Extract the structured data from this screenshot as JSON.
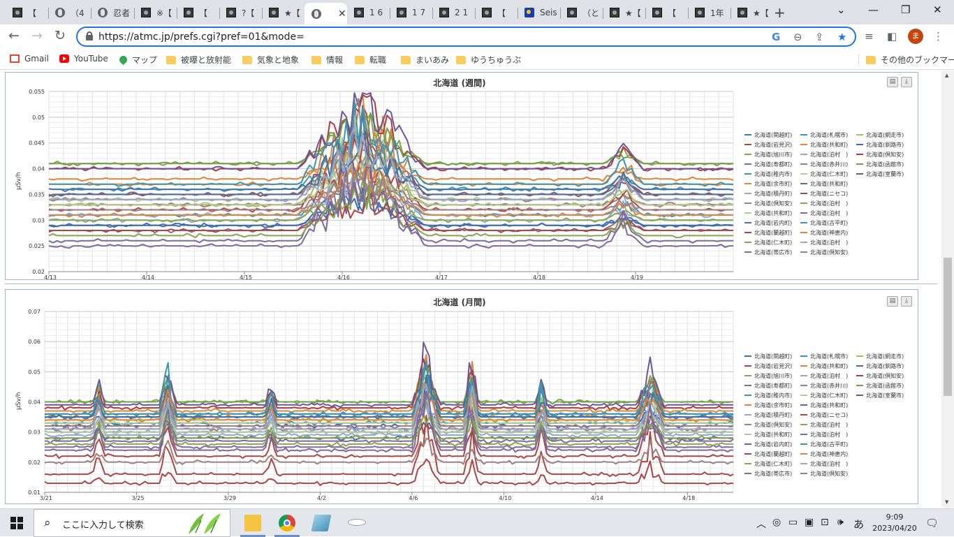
{
  "browser": {
    "tabs": [
      {
        "label": "【",
        "icon": "atmc-favicon",
        "active": false
      },
      {
        "label": "（4",
        "icon": "globe-favicon",
        "active": false
      },
      {
        "label": "忍者",
        "icon": "globe-favicon",
        "active": false
      },
      {
        "label": "※【",
        "icon": "atmc-favicon",
        "active": false
      },
      {
        "label": "【",
        "icon": "atmc-favicon",
        "active": false
      },
      {
        "label": "?【",
        "icon": "atmc-favicon",
        "active": false
      },
      {
        "label": "★【",
        "icon": "atmc-favicon",
        "active": false
      },
      {
        "label": "",
        "icon": "globe-favicon",
        "active": true
      },
      {
        "label": "1 6",
        "icon": "atmc-favicon",
        "active": false
      },
      {
        "label": "1 7",
        "icon": "atmc-favicon",
        "active": false
      },
      {
        "label": "2 1",
        "icon": "atmc-favicon",
        "active": false
      },
      {
        "label": "【",
        "icon": "atmc-favicon",
        "active": false
      },
      {
        "label": "Seis",
        "icon": "seis-favicon",
        "active": false
      },
      {
        "label": "（と",
        "icon": "atmc-favicon",
        "active": false
      },
      {
        "label": "★【",
        "icon": "atmc-favicon",
        "active": false
      },
      {
        "label": "【",
        "icon": "atmc-favicon",
        "active": false
      },
      {
        "label": "1年",
        "icon": "atmc-favicon",
        "active": false
      },
      {
        "label": "★【",
        "icon": "atmc-favicon",
        "active": false
      }
    ],
    "url": "https://atmc.jp/prefs.cgi?pref=01&mode=",
    "avatar_initial": "ま",
    "bookmarks": [
      {
        "label": "Gmail",
        "icon": "gmail-icon"
      },
      {
        "label": "YouTube",
        "icon": "youtube-icon"
      },
      {
        "label": "マップ",
        "icon": "maps-icon"
      },
      {
        "label": "被曝と放射能",
        "icon": "folder-icon"
      },
      {
        "label": "気象と地象",
        "icon": "folder-icon"
      },
      {
        "label": "情報",
        "icon": "folder-icon"
      },
      {
        "label": "転職",
        "icon": "folder-icon"
      },
      {
        "label": "まいあみ",
        "icon": "folder-icon"
      },
      {
        "label": "ゆうちゅうぶ",
        "icon": "folder-icon"
      }
    ],
    "other_bookmarks": "その他のブックマーク",
    "accent": "#1a73e8"
  },
  "taskbar": {
    "search_placeholder": "ここに入力して検索",
    "time": "9:09",
    "date": "2023/04/20",
    "ime": "あ"
  },
  "legend_labels": [
    "北海道(関越町)",
    "北海道(札幌市)",
    "北海道(網走市)",
    "北海道(岩見沢)",
    "北海道(共和町)",
    "北海道(釧路市)",
    "北海道(旭川市)",
    "北海道(泊村　)",
    "北海道(倶知安)",
    "北海道(寿都町)",
    "北海道(赤井川)",
    "北海道(函館市)",
    "北海道(稚内市)",
    "北海道(仁木町)",
    "北海道(室蘭市)",
    "北海道(余市町)",
    "北海道(共和町)",
    "北海道(積丹町)",
    "北海道(ニセコ)",
    "北海道(倶知安)",
    "北海道(泊村　)",
    "北海道(共和町)",
    "北海道(泊村　)",
    "北海道(岩内町)",
    "北海道(古平町)",
    "北海道(蘭越町)",
    "北海道(神恵内)",
    "北海道(仁木町)",
    "北海道(泊村　)",
    "北海道(帯広市)",
    "北海道(倶知安)"
  ],
  "legend_colors": [
    "#4572A7",
    "#2F9BBF",
    "#A0C060",
    "#AA4643",
    "#DB843D",
    "#3D6AB0",
    "#89A54E",
    "#92A8CD",
    "#B03A3A",
    "#80699B",
    "#A47D7C",
    "#6FA04C",
    "#3D96AE",
    "#B5CA92",
    "#6B559B",
    "#DB843D",
    "#4572A7",
    "#92A8CD",
    "#AA4643",
    "#A47D7C",
    "#89A54E",
    "#B5CA92",
    "#80699B",
    "#4572A7",
    "#3D96AE",
    "#AA4643",
    "#DB843D",
    "#89A54E",
    "#92A8CD",
    "#80699B",
    "#A47D7C"
  ],
  "chart_data": [
    {
      "type": "line",
      "title": "北海道 (週間)",
      "ylabel": "µSv/h",
      "ylim": [
        0.02,
        0.055
      ],
      "yticks": [
        "0.02",
        "0.025",
        "0.03",
        "0.035",
        "0.04",
        "0.045",
        "0.05",
        "0.055"
      ],
      "xlim": [
        0,
        7
      ],
      "xticks": [
        {
          "v": 0,
          "label": "4/13"
        },
        {
          "v": 1,
          "label": "4/14"
        },
        {
          "v": 2,
          "label": "4/15"
        },
        {
          "v": 3,
          "label": "4/16"
        },
        {
          "v": 4,
          "label": "4/17"
        },
        {
          "v": 5,
          "label": "4/18"
        },
        {
          "v": 6,
          "label": "4/19"
        }
      ],
      "grid": true,
      "legend_position": "right",
      "baselines": [
        0.029,
        0.031,
        0.033,
        0.035,
        0.037,
        0.029,
        0.041,
        0.031,
        0.04,
        0.026,
        0.033,
        0.041,
        0.036,
        0.034,
        0.04,
        0.038,
        0.036,
        0.03,
        0.032,
        0.034,
        0.03,
        0.033,
        0.028,
        0.035,
        0.037,
        0.028,
        0.031,
        0.027,
        0.034,
        0.025,
        0.032
      ],
      "events": [
        {
          "x0": 2.55,
          "x1": 3.85,
          "peak": 3.2,
          "amp": 0.0145
        },
        {
          "x0": 5.7,
          "x1": 6.1,
          "peak": 5.88,
          "amp": 0.004
        }
      ]
    },
    {
      "type": "line",
      "title": "北海道 (月間)",
      "ylabel": "µSv/h",
      "ylim": [
        0.01,
        0.07
      ],
      "yticks": [
        "0.01",
        "0.02",
        "0.03",
        "0.04",
        "0.05",
        "0.06",
        "0.07"
      ],
      "xlim": [
        0,
        30
      ],
      "xticks": [
        {
          "v": 0,
          "label": "3/21"
        },
        {
          "v": 4,
          "label": "3/25"
        },
        {
          "v": 8,
          "label": "3/29"
        },
        {
          "v": 12,
          "label": "4/2"
        },
        {
          "v": 16,
          "label": "4/6"
        },
        {
          "v": 20,
          "label": "4/10"
        },
        {
          "v": 24,
          "label": "4/14"
        },
        {
          "v": 28,
          "label": "4/18"
        }
      ],
      "grid": true,
      "legend_position": "right",
      "baselines": [
        0.028,
        0.033,
        0.034,
        0.022,
        0.035,
        0.032,
        0.04,
        0.03,
        0.038,
        0.025,
        0.031,
        0.04,
        0.036,
        0.033,
        0.039,
        0.037,
        0.035,
        0.029,
        0.016,
        0.032,
        0.028,
        0.03,
        0.027,
        0.035,
        0.036,
        0.013,
        0.034,
        0.026,
        0.031,
        0.024,
        0.02
      ],
      "events": [
        {
          "x0": 2.1,
          "x1": 2.6,
          "peak": 2.35,
          "amp": 0.008
        },
        {
          "x0": 5.0,
          "x1": 5.7,
          "peak": 5.35,
          "amp": 0.014
        },
        {
          "x0": 9.6,
          "x1": 10.1,
          "peak": 9.85,
          "amp": 0.007
        },
        {
          "x0": 16.0,
          "x1": 17.2,
          "peak": 16.6,
          "amp": 0.018
        },
        {
          "x0": 18.3,
          "x1": 18.9,
          "peak": 18.6,
          "amp": 0.016
        },
        {
          "x0": 21.4,
          "x1": 21.9,
          "peak": 21.65,
          "amp": 0.009
        },
        {
          "x0": 25.8,
          "x1": 27.0,
          "peak": 26.4,
          "amp": 0.012
        }
      ]
    }
  ]
}
